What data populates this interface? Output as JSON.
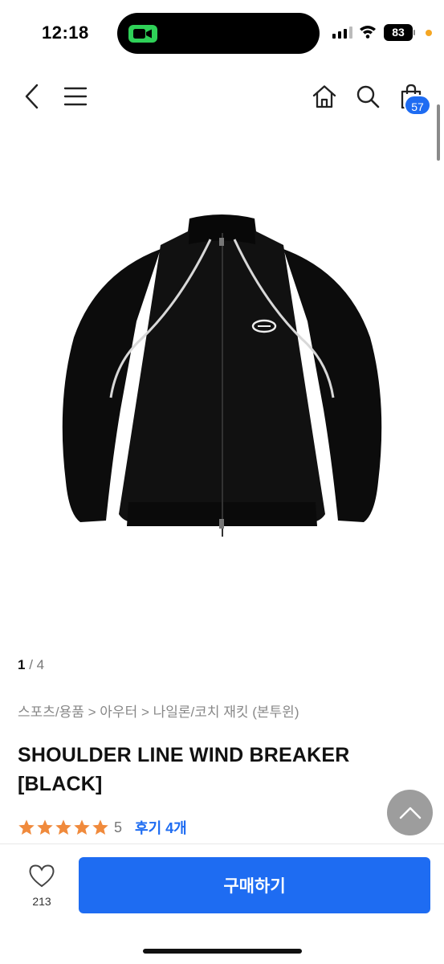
{
  "status_bar": {
    "time": "12:18",
    "battery": "83",
    "icons": [
      "facetime-camera-icon",
      "cellular-signal-icon",
      "wifi-icon",
      "battery-icon"
    ]
  },
  "nav": {
    "icons": [
      "back-chevron-icon",
      "hamburger-menu-icon",
      "home-icon",
      "search-icon",
      "shopping-bag-icon"
    ],
    "cart_count": "57"
  },
  "gallery": {
    "current": "1",
    "separator": " / ",
    "total": "4"
  },
  "breadcrumb": {
    "path": "스포츠/용품 > 아우터 > 나일론/코치 재킷 (본투윈)"
  },
  "product": {
    "title": "SHOULDER LINE WIND BREAKER [BLACK]",
    "rating": "5",
    "stars": 5,
    "review_label": "후기 4개"
  },
  "bottom_bar": {
    "like_count": "213",
    "buy_label": "구매하기"
  },
  "colors": {
    "accent": "#1e6cf2",
    "star": "#f08a3c",
    "facetime": "#2fd158"
  }
}
